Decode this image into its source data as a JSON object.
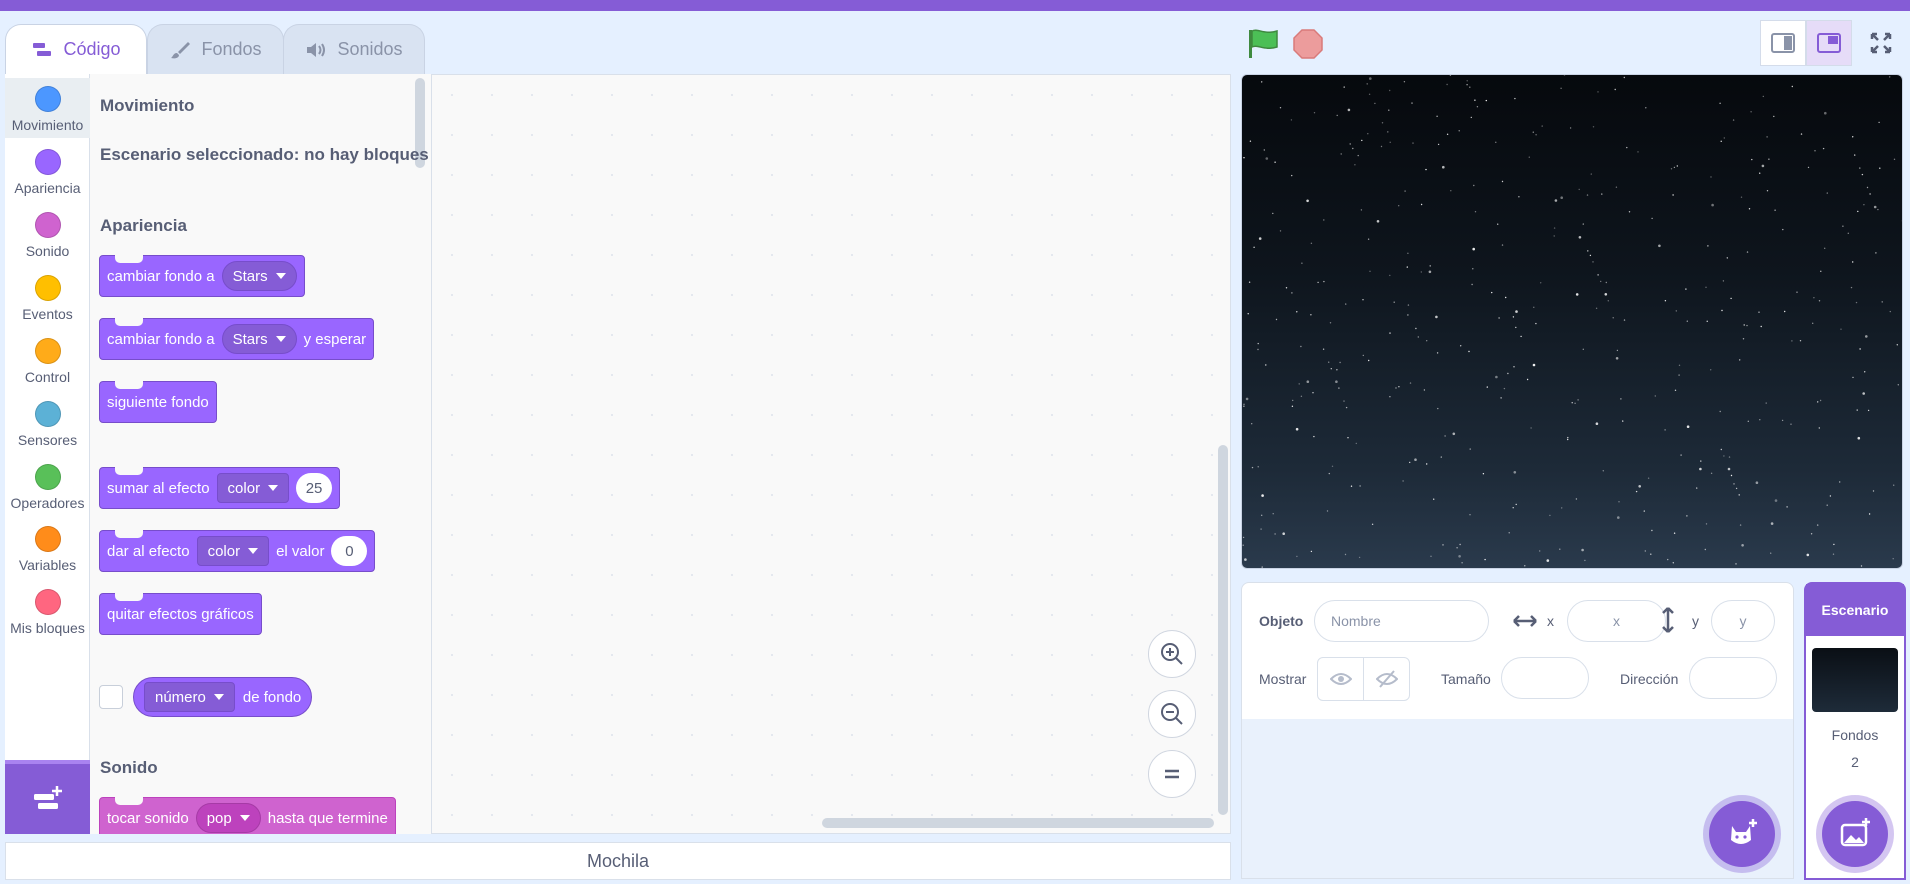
{
  "tabs": {
    "code": "Código",
    "backdrops": "Fondos",
    "sounds": "Sonidos"
  },
  "categories": [
    {
      "label": "Movimiento",
      "color": "#4c97ff"
    },
    {
      "label": "Apariencia",
      "color": "#9966ff"
    },
    {
      "label": "Sonido",
      "color": "#cf63cf"
    },
    {
      "label": "Eventos",
      "color": "#ffbf00"
    },
    {
      "label": "Control",
      "color": "#ffab19"
    },
    {
      "label": "Sensores",
      "color": "#5cb1d6"
    },
    {
      "label": "Operadores",
      "color": "#59c059"
    },
    {
      "label": "Variables",
      "color": "#ff8c1a"
    },
    {
      "label": "Mis bloques",
      "color": "#ff6680"
    }
  ],
  "palette": {
    "motion_header": "Movimiento",
    "motion_note": "Escenario seleccionado: no hay bloques",
    "looks_header": "Apariencia",
    "sound_header": "Sonido",
    "blocks": {
      "switch_backdrop": {
        "text": "cambiar fondo a",
        "menu": "Stars"
      },
      "switch_backdrop_wait": {
        "text": "cambiar fondo a",
        "menu": "Stars",
        "suffix": "y esperar"
      },
      "next_backdrop": {
        "text": "siguiente fondo"
      },
      "change_effect": {
        "text": "sumar al efecto",
        "menu": "color",
        "value": "25"
      },
      "set_effect": {
        "text": "dar al efecto",
        "menu": "color",
        "mid": "el valor",
        "value": "0"
      },
      "clear_effects": {
        "text": "quitar efectos gráficos"
      },
      "backdrop_number": {
        "menu": "número",
        "suffix": "de fondo"
      },
      "play_sound": {
        "text": "tocar sonido",
        "menu": "pop",
        "suffix": "hasta que termine"
      }
    }
  },
  "backpack": "Mochila",
  "sprite_info": {
    "sprite_label": "Objeto",
    "name_placeholder": "Nombre",
    "x_label": "x",
    "x_placeholder": "x",
    "y_label": "y",
    "y_placeholder": "y",
    "show_label": "Mostrar",
    "size_label": "Tamaño",
    "direction_label": "Dirección"
  },
  "stage_selector": {
    "title": "Escenario",
    "backdrops_label": "Fondos",
    "backdrops_count": "2"
  },
  "colors": {
    "accent": "#855cd6",
    "looks": "#9966ff",
    "sound": "#cf63cf"
  }
}
